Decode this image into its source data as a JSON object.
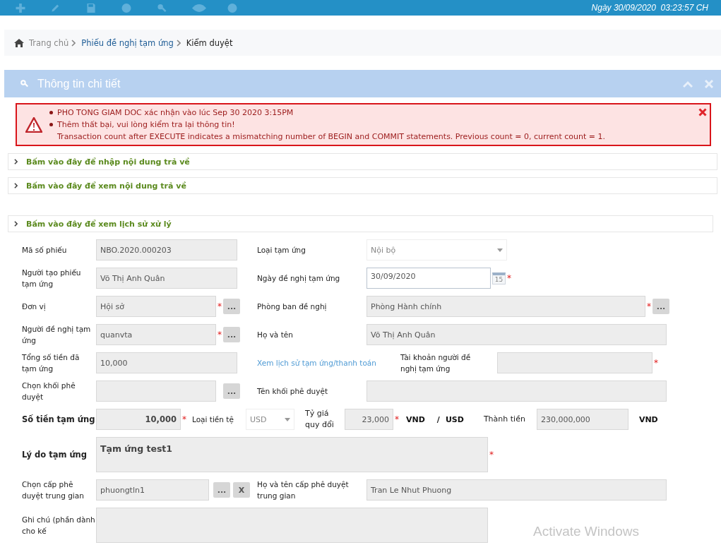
{
  "top_bar": {
    "datetime": "Ngày 30/09/2020  03:23:57 CH"
  },
  "breadcrumb": [
    {
      "label": "Trang chủ",
      "kind": "home"
    },
    {
      "label": "Phiếu đề nghị tạm ứng",
      "kind": "link"
    },
    {
      "label": "Kiểm duyệt",
      "kind": "current"
    }
  ],
  "panel": {
    "title": "Thông tin chi tiết"
  },
  "alert": {
    "messages": [
      "PHO TONG GIAM DOC xác nhận vào lúc Sep 30 2020  3:15PM",
      "Thêm thất bại, vui lòng kiểm tra lại thông tin!"
    ],
    "detail": "Transaction count after EXECUTE indicates a mismatching number of BEGIN and COMMIT statements. Previous count = 0, current count = 1."
  },
  "toggles": [
    {
      "label": "Bấm vào đây để nhập nội dung trả về",
      "expanded": false
    },
    {
      "label": "Bấm vào đây để xem nội dung trả về",
      "expanded": false
    }
  ],
  "history_toggle": {
    "label": "Bấm vào đây để xem lịch sử xử lý",
    "expanded": false
  },
  "form": {
    "rows": [
      {
        "left": {
          "label": "Mã số phiếu",
          "value": "NBO.2020.000203"
        },
        "right": {
          "label": "Loại tạm ứng",
          "kind": "select",
          "value": "Nội bộ"
        }
      },
      {
        "left": {
          "label": "Người tạo phiếu tạm ứng",
          "value": "Võ Thị Anh Quân"
        },
        "right": {
          "label": "Ngày đề nghị tạm ứng",
          "kind": "date",
          "value": "30/09/2020",
          "calendar_day": "15",
          "required_mark": "*"
        }
      },
      {
        "left": {
          "label": "Đơn vị",
          "value": "Hội sở",
          "required_mark": "*",
          "picker": "..."
        },
        "right": {
          "label": "Phòng ban đề nghị",
          "value": "Phòng Hành chính",
          "required_mark": "*",
          "picker": "..."
        }
      },
      {
        "left": {
          "label": "Người đề nghị tạm ứng",
          "value": "quanvta",
          "required_mark": "*",
          "picker": "..."
        },
        "right": {
          "label": "Họ và tên",
          "value": "Võ Thị Anh Quân"
        }
      },
      {
        "left": {
          "label": "Tổng số tiền đã tạm ứng",
          "value": "10,000"
        },
        "right": {
          "link": "Xem lịch sử tạm ứng/thanh toán",
          "label": "Tài khoản người đề nghị tạm ứng",
          "required_mark": "*"
        }
      },
      {
        "left": {
          "label": "Chọn khối phê duyệt",
          "picker": "..."
        },
        "right": {
          "label": "Tên khối phê duyệt"
        }
      }
    ],
    "amount": {
      "label": "Số tiền tạm ứng",
      "value": "10,000",
      "required_mark": "*",
      "currency_label": "Loại tiền tệ",
      "currency": "USD",
      "rate_label": "Tỷ giá quy đổi",
      "rate": "23,000",
      "rate_required_mark": "*",
      "rate_unit": "VND",
      "slash": "/",
      "rate_base": "USD",
      "total_label": "Thành tiền",
      "total": "230,000,000",
      "total_unit": "VND"
    },
    "reason": {
      "label": "Lý do tạm ứng",
      "value": "Tạm ứng test1",
      "required_mark": "*"
    },
    "intermediate": {
      "left": {
        "label": "Chọn cấp phê duyệt trung gian",
        "value": "phuongtln1",
        "picker": "...",
        "clear": "X"
      },
      "right": {
        "label": "Họ và tên cấp phê duyệt trung gian",
        "value": "Tran Le Nhut Phuong"
      }
    },
    "note": {
      "label": "Ghi chú (phần dành cho kế"
    }
  },
  "os_overlay": {
    "text": "Activate Windows"
  }
}
